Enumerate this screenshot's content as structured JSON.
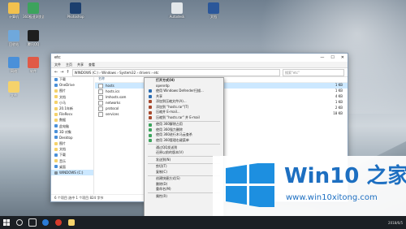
{
  "desktop": {
    "icons": [
      {
        "name": "computer-icon",
        "label": "计算机",
        "color": "#f2c14e"
      },
      {
        "name": "browser-icon",
        "label": "360极速浏览器",
        "color": "#3da35d"
      },
      {
        "name": "recycle-icon",
        "label": "回收站",
        "color": "#6fa8dc"
      },
      {
        "name": "qq-icon",
        "label": "腾讯QQ",
        "color": "#1e1e1e"
      },
      {
        "name": "network-icon",
        "label": "网络",
        "color": "#4a90d9"
      },
      {
        "name": "app-icon",
        "label": "软件",
        "color": "#e05a47"
      },
      {
        "name": "folder-icon",
        "label": "文件",
        "color": "#f5d26b"
      },
      {
        "name": "photoshop-icon",
        "label": "Photoshop",
        "color": "#1c3f6e"
      },
      {
        "name": "doc-icon",
        "label": "Autodesk",
        "color": "#e3e7ea"
      },
      {
        "name": "word-icon",
        "label": "文档",
        "color": "#2b579a"
      }
    ]
  },
  "explorer": {
    "window_title": "etc",
    "tabs": [
      "文件",
      "主页",
      "共享",
      "查看"
    ],
    "address": "WINDOWS (C:) › Windows › System32 › drivers › etc",
    "search_placeholder": "搜索\"etc\"",
    "nav": [
      {
        "label": "下载",
        "color": "#4a90d9"
      },
      {
        "label": "OneDrive",
        "color": "#4a90d9"
      },
      {
        "label": "图片",
        "color": "#f5d26b"
      },
      {
        "label": "文档",
        "color": "#f5d26b"
      },
      {
        "label": "小马",
        "color": "#f5d26b"
      },
      {
        "label": "20.1年新",
        "color": "#f5d26b"
      },
      {
        "label": "FileRecv",
        "color": "#f5d26b"
      },
      {
        "label": "数据",
        "color": "#f5d26b"
      },
      {
        "label": "此电脑",
        "color": "#4a90d9"
      },
      {
        "label": "3D 对象",
        "color": "#4a90d9"
      },
      {
        "label": "Desktop",
        "color": "#4a90d9"
      },
      {
        "label": "图片",
        "color": "#f5d26b"
      },
      {
        "label": "文档",
        "color": "#f5d26b"
      },
      {
        "label": "下载",
        "color": "#4a90d9"
      },
      {
        "label": "音乐",
        "color": "#f5d26b"
      },
      {
        "label": "桌面",
        "color": "#4a90d9"
      },
      {
        "label": "WINDOWS (C:)",
        "color": "#7f8c96",
        "selected": true
      }
    ],
    "column_header": "名称",
    "files": [
      {
        "name": "hosts",
        "selected": true
      },
      {
        "name": "hosts.ics"
      },
      {
        "name": "lmhosts.sam"
      },
      {
        "name": "networks"
      },
      {
        "name": "protocol"
      },
      {
        "name": "services"
      }
    ],
    "sizes": [
      "1 KB",
      "1 KB",
      "4 KB",
      "1 KB",
      "2 KB",
      "18 KB"
    ],
    "status": "6 个项目   选中 1 个项目  824 字节"
  },
  "context_menu": {
    "items": [
      {
        "label": "打开方式(H)",
        "bold": true
      },
      {
        "label": "openrdp"
      },
      {
        "label": "使用 Windows Defender扫描...",
        "color": "#2b6cb0"
      },
      {
        "label": "共享",
        "color": "#2b6cb0"
      },
      {
        "label": "添加到压缩文件(A)...",
        "color": "#a84a2e"
      },
      {
        "label": "添加到 \"hosts.rar\"(T)",
        "color": "#a84a2e"
      },
      {
        "label": "压缩并 E-mail...",
        "color": "#a84a2e"
      },
      {
        "label": "压缩到 \"hosts.rar\" 并 E-mail",
        "color": "#a84a2e"
      },
      {
        "sep": true
      },
      {
        "label": "使用 360解除占用",
        "color": "#3da35d"
      },
      {
        "label": "使用 360强力删除",
        "color": "#3da35d"
      },
      {
        "label": "使用 360进行木马云查杀",
        "color": "#3da35d"
      },
      {
        "label": "使用 360管理右键菜单",
        "color": "#3da35d"
      },
      {
        "sep": true
      },
      {
        "label": "通过QQ发送到"
      },
      {
        "label": "还原以前的版本(V)"
      },
      {
        "sep": true
      },
      {
        "label": "发送到(N)"
      },
      {
        "sep": true
      },
      {
        "label": "剪切(T)"
      },
      {
        "label": "复制(C)"
      },
      {
        "sep": true
      },
      {
        "label": "创建快捷方式(S)"
      },
      {
        "label": "删除(D)"
      },
      {
        "label": "重命名(M)"
      },
      {
        "sep": true
      },
      {
        "label": "属性(R)"
      }
    ]
  },
  "brand": {
    "logo_text": "Win10 之家",
    "url": "www.win10xitong.com",
    "color": "#1d6fc1"
  },
  "taskbar": {
    "time": "2018/6/5"
  }
}
